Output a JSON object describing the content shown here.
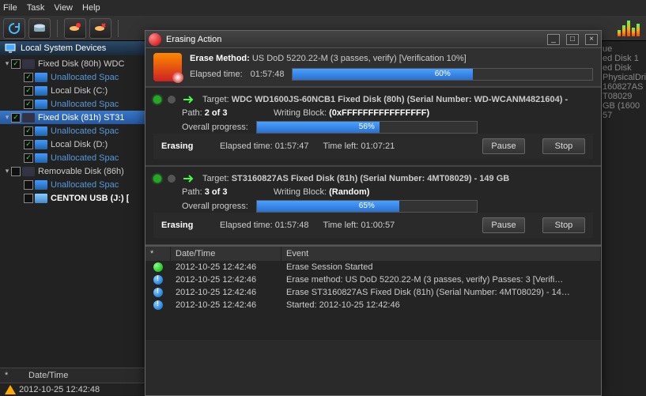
{
  "menu": {
    "file": "File",
    "task": "Task",
    "view": "View",
    "help": "Help"
  },
  "left_panel": {
    "title": "Local System Devices"
  },
  "tree": [
    {
      "d": 0,
      "arrow": "▾",
      "chk": true,
      "ico": "dark",
      "cls": "",
      "label": "Fixed Disk (80h) WDC"
    },
    {
      "d": 1,
      "arrow": "",
      "chk": true,
      "ico": "blue",
      "cls": "un",
      "label": "Unallocated Spac"
    },
    {
      "d": 1,
      "arrow": "",
      "chk": true,
      "ico": "blue",
      "cls": "",
      "label": "Local Disk (C:)"
    },
    {
      "d": 1,
      "arrow": "",
      "chk": true,
      "ico": "blue",
      "cls": "un",
      "label": "Unallocated Spac"
    },
    {
      "d": 0,
      "arrow": "▾",
      "chk": true,
      "ico": "dark",
      "cls": "sel",
      "label": "Fixed Disk (81h) ST31"
    },
    {
      "d": 1,
      "arrow": "",
      "chk": true,
      "ico": "blue",
      "cls": "un",
      "label": "Unallocated Spac"
    },
    {
      "d": 1,
      "arrow": "",
      "chk": true,
      "ico": "blue",
      "cls": "",
      "label": "Local Disk (D:)"
    },
    {
      "d": 1,
      "arrow": "",
      "chk": true,
      "ico": "blue",
      "cls": "un",
      "label": "Unallocated Spac"
    },
    {
      "d": 0,
      "arrow": "▾",
      "chk": false,
      "ico": "dark",
      "cls": "",
      "label": "Removable Disk (86h)"
    },
    {
      "d": 1,
      "arrow": "",
      "chk": false,
      "ico": "blue",
      "cls": "un",
      "label": "Unallocated Spac"
    },
    {
      "d": 1,
      "arrow": "",
      "chk": false,
      "ico": "usb",
      "cls": "bold",
      "label": "CENTON USB (J:) ["
    }
  ],
  "bottom_left": {
    "col": "Date/Time",
    "star": "*",
    "row_dt": "2012-10-25 12:42:48"
  },
  "props": {
    "lines": [
      "ue",
      "ed Disk 1",
      "ed Disk",
      "",
      "PhysicalDri",
      "160827AS",
      "T08029",
      "",
      "GB (1600",
      "57"
    ]
  },
  "dialog": {
    "title": "Erasing Action",
    "method_label": "Erase Method:",
    "method_value": "US DoD 5220.22-M (3 passes, verify) [Verification 10%]",
    "elapsed_label": "Elapsed time:",
    "elapsed_value": "01:57:48",
    "overall_pct": "60%",
    "targets": [
      {
        "target_label": "Target:",
        "target_value": "WDC WD1600JS-60NCB1 Fixed Disk (80h) (Serial Number: WD-WCANM4821604) -",
        "path_label": "Path:",
        "path_value": "2 of 3",
        "wb_label": "Writing Block:",
        "wb_value": "(0xFFFFFFFFFFFFFFFF)",
        "op_label": "Overall progress:",
        "op_pct": "56%",
        "status": "Erasing",
        "elapsed_label": "Elapsed time:",
        "elapsed": "01:57:47",
        "left_label": "Time left:",
        "left": "01:07:21",
        "pause": "Pause",
        "stop": "Stop"
      },
      {
        "target_label": "Target:",
        "target_value": "ST3160827AS Fixed Disk (81h) (Serial Number: 4MT08029) - 149 GB",
        "path_label": "Path:",
        "path_value": "3 of 3",
        "wb_label": "Writing Block:",
        "wb_value": "(Random)",
        "op_label": "Overall progress:",
        "op_pct": "65%",
        "status": "Erasing",
        "elapsed_label": "Elapsed time:",
        "elapsed": "01:57:48",
        "left_label": "Time left:",
        "left": "01:00:57",
        "pause": "Pause",
        "stop": "Stop"
      }
    ],
    "log": {
      "star": "*",
      "col_dt": "Date/Time",
      "col_ev": "Event",
      "rows": [
        {
          "ico": "green",
          "dt": "2012-10-25 12:42:46",
          "ev": "Erase Session Started"
        },
        {
          "ico": "blue",
          "dt": "2012-10-25 12:42:46",
          "ev": "Erase method: US DoD 5220.22-M (3 passes, verify) Passes: 3 [Verifi…"
        },
        {
          "ico": "blue",
          "dt": "2012-10-25 12:42:46",
          "ev": "Erase ST3160827AS Fixed Disk (81h) (Serial Number: 4MT08029) - 14…"
        },
        {
          "ico": "blue",
          "dt": "2012-10-25 12:42:46",
          "ev": "Started: 2012-10-25 12:42:46"
        }
      ]
    }
  }
}
